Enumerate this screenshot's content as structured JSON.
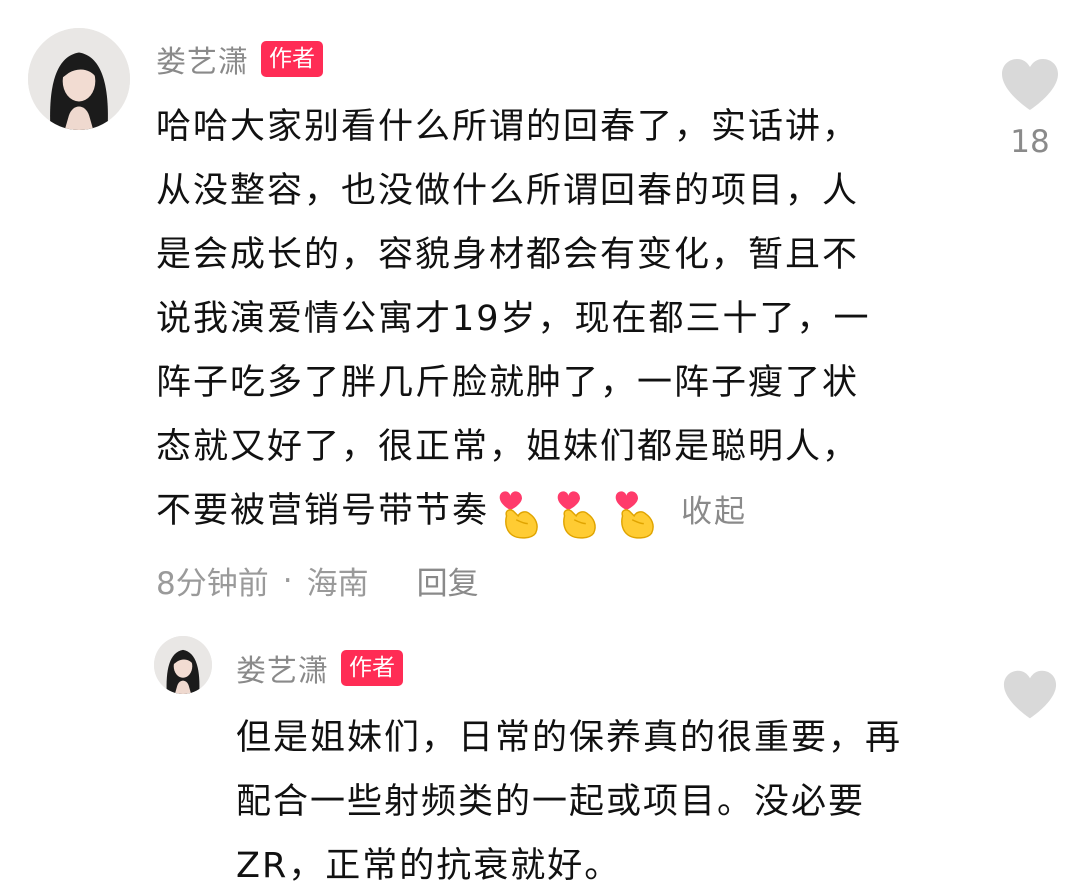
{
  "comment": {
    "username": "娄艺潇",
    "badge": "作者",
    "lines": [
      "哈哈大家别看什么所谓的回春了，实话讲，",
      "从没整容，也没做什么所谓回春的项目，人",
      "是会成长的，容貌身材都会有变化，暂且不",
      "说我演爱情公寓才19岁，现在都三十了，一",
      "阵子吃多了胖几斤脸就肿了，一阵子瘦了状",
      "态就又好了，很正常，姐妹们都是聪明人，",
      "不要被营销号带节奏"
    ],
    "emojis": [
      "heart-hands-emoji",
      "heart-hands-emoji",
      "heart-hands-emoji"
    ],
    "collapse_label": "收起",
    "time": "8分钟前",
    "separator": "·",
    "location": "海南",
    "reply_label": "回复",
    "like_count": "18"
  },
  "reply": {
    "username": "娄艺潇",
    "badge": "作者",
    "lines": [
      "但是姐妹们，日常的保养真的很重要，再",
      "配合一些射频类的一起或项目。没必要",
      "ZR，正常的抗衰就好。"
    ]
  },
  "colors": {
    "badge_bg": "#ff2c55",
    "muted_text": "#8a8a8a",
    "body_text": "#111111",
    "heart_outline": "#d9d9d9"
  }
}
